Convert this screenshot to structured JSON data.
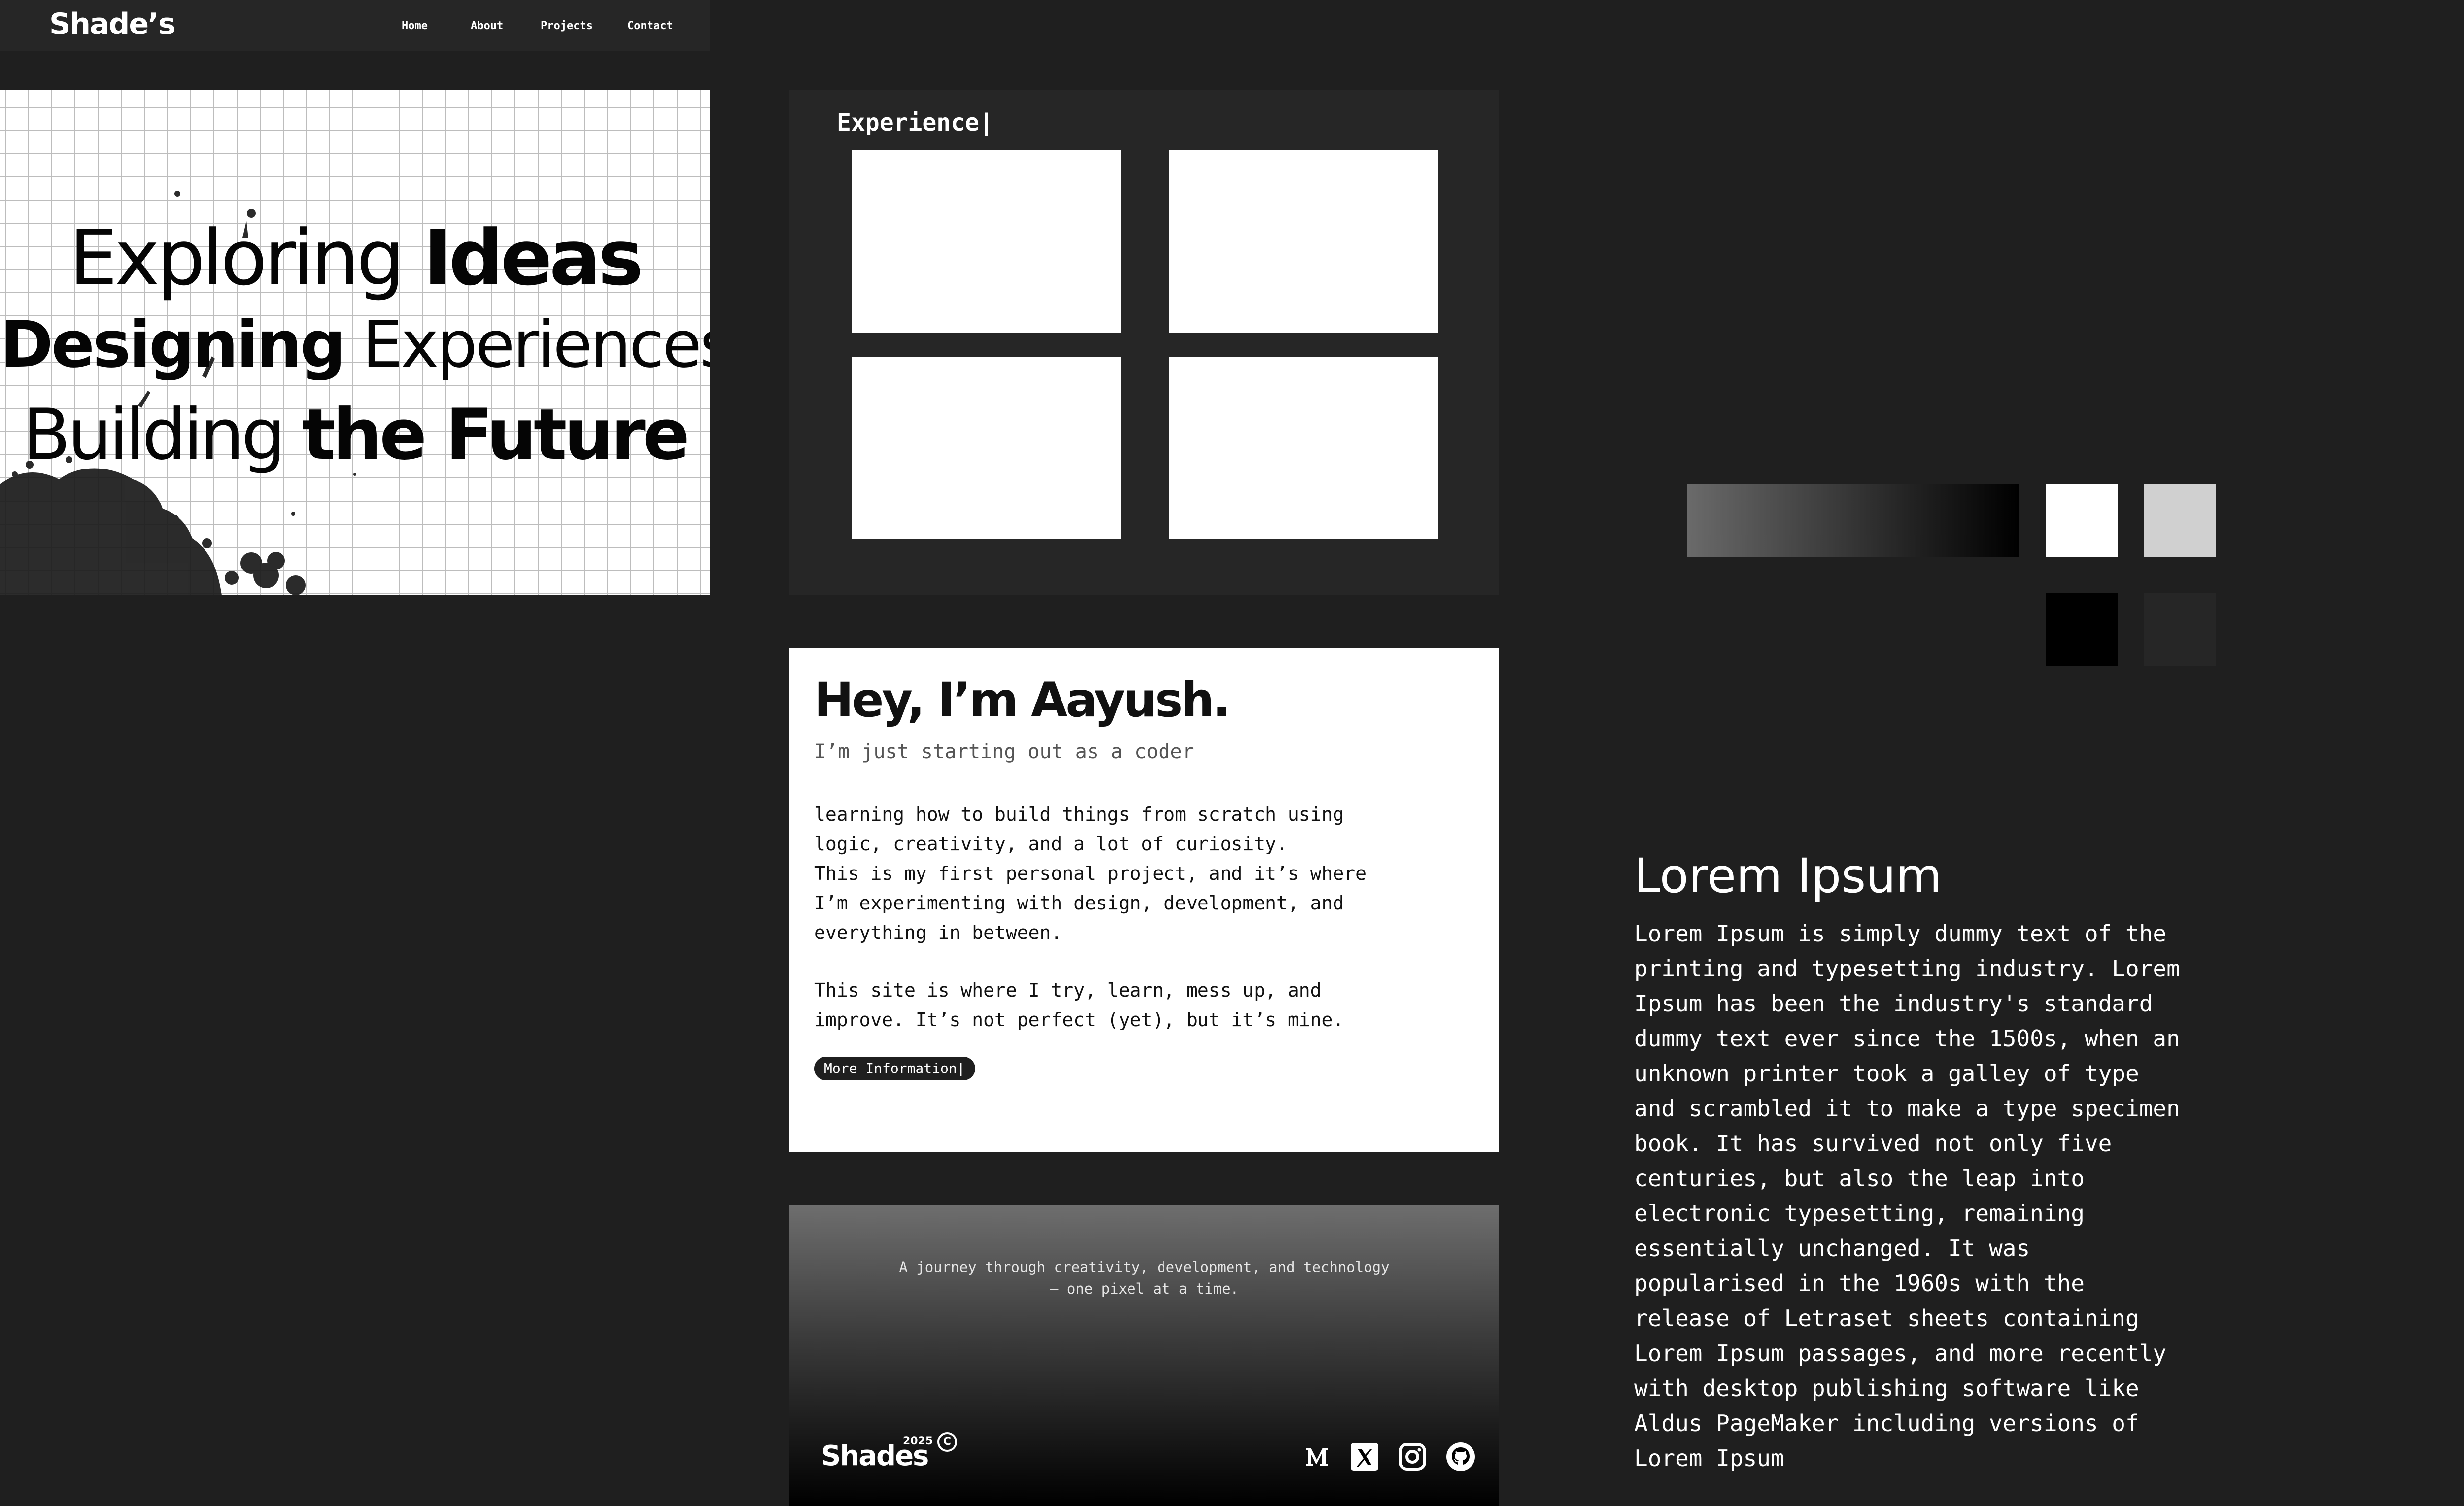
{
  "nav": {
    "logo": "Shade’s",
    "links": [
      "Home",
      "About",
      "Projects",
      "Contact"
    ]
  },
  "hero": {
    "line1": {
      "normal": "Exploring ",
      "bold": "Ideas"
    },
    "line2": {
      "bold": "Designing",
      "normal": " Experiences"
    },
    "line3": {
      "normal": "Building ",
      "bold": "the Future"
    }
  },
  "experience": {
    "title": "Experience|"
  },
  "about": {
    "heading": "Hey, I’m Aayush.",
    "subheading": "I’m just starting out as a coder",
    "paragraph1": [
      "learning how to build things from scratch using",
      "logic, creativity, and a lot of curiosity.",
      "This is my first personal project, and it’s where",
      "I’m experimenting with design, development, and",
      "everything in between."
    ],
    "paragraph2": [
      "This site is where I try, learn, mess up, and",
      "improve. It’s not perfect (yet), but it’s mine."
    ],
    "button_label": "More Information|"
  },
  "footer": {
    "tagline": [
      "A journey through creativity, development, and technology",
      "— one pixel at a time."
    ],
    "logo": "Shades",
    "year": "2025",
    "copyright_symbol": "C",
    "social_icons": [
      "medium-icon",
      "x-icon",
      "instagram-icon",
      "github-icon"
    ]
  },
  "palette": {
    "colors": [
      "#6a6a6a-to-#000000 gradient",
      "#ffffff",
      "#d0d0d0",
      "#000000",
      "#262626"
    ]
  },
  "lorem": {
    "title": "Lorem Ipsum",
    "body": [
      "Lorem Ipsum is simply dummy text of the",
      "printing and typesetting industry. Lorem",
      "Ipsum has been the industry's standard",
      "dummy text ever since the 1500s, when an",
      "unknown printer took a galley of type",
      "and scrambled it to make a type specimen",
      "book. It has survived not only five",
      "centuries, but also the leap into",
      "electronic typesetting, remaining",
      "essentially unchanged. It was",
      "popularised in the 1960s with the",
      "release of Letraset sheets containing",
      "Lorem Ipsum passages, and more recently",
      "with desktop publishing software like",
      "Aldus PageMaker including versions of",
      "Lorem Ipsum"
    ]
  },
  "colors": {
    "page_bg": "#1f1f1f",
    "panel_bg": "#262626",
    "text_light": "#ffffff",
    "text_dark": "#111111"
  }
}
